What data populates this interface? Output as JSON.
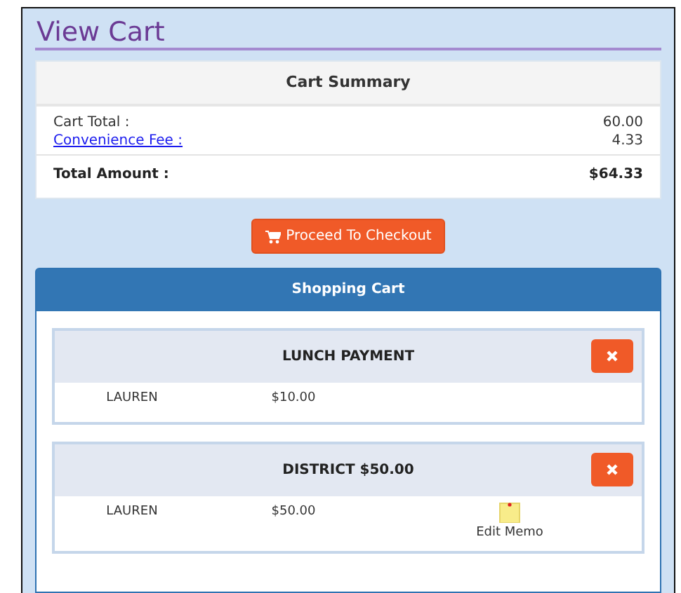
{
  "title": "View Cart",
  "summary": {
    "heading": "Cart Summary",
    "lines": [
      {
        "label": "Cart Total :",
        "value": "60.00",
        "kind": "text"
      },
      {
        "label": "Convenience Fee :",
        "value": "4.33",
        "kind": "link"
      }
    ],
    "total": {
      "label": "Total Amount :",
      "value": "$64.33"
    }
  },
  "checkout": {
    "label": "Proceed To Checkout"
  },
  "cart": {
    "heading": "Shopping Cart",
    "items": [
      {
        "name": "LUNCH PAYMENT",
        "person": "LAUREN",
        "amount": "$10.00"
      },
      {
        "name": "DISTRICT $50.00",
        "person": "LAUREN",
        "amount": "$50.00",
        "memo": "Edit Memo"
      }
    ]
  }
}
